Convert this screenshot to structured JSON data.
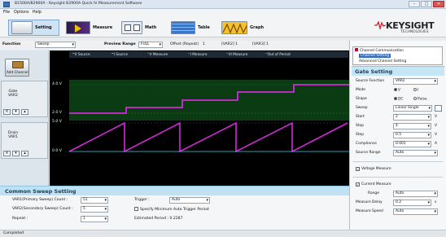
{
  "window": {
    "title": "B1500A/B2900A - Keysight B2900A Quick IV Measurement Software",
    "min_glyph": "–",
    "max_glyph": "□",
    "close_glyph": "✕"
  },
  "menu": [
    "File",
    "Options",
    "Help"
  ],
  "toolbar": {
    "setting": "Setting",
    "measure": "Measure",
    "math": "Math",
    "table": "Table",
    "graph": "Graph"
  },
  "logo": {
    "name": "KEYSIGHT",
    "sub": "TECHNOLOGIES"
  },
  "function_row": {
    "function_label": "Function",
    "function_value": "Sweep",
    "preview_label": "Preview Range",
    "preview_value": "FULL",
    "offset_label": "Offset (Repeat)",
    "offset_value": "1",
    "v1_label": "[VAR2] 1",
    "v2_label": "[VAR3] 1"
  },
  "channels": {
    "add_label": "Add Channel",
    "gate_label": "Gate\nVAR2",
    "drain_label": "Drain\nVAR1"
  },
  "legend": [
    "V Source",
    "I Source",
    "V Measure",
    "I Measure",
    "VI Measure",
    "Out of Period"
  ],
  "graph_axes": {
    "gate_top": "4.0 V",
    "gate_bottom": "2.0 V",
    "drain_top": "5.0 V",
    "drain_bottom": "0.0 V"
  },
  "common_sweep": {
    "title": "Common Sweep Setting",
    "var1_label": "VAR1(Primary Sweep) Count :",
    "var1_value": "51",
    "var2_label": "VAR2(Secondary Sweep) Count :",
    "var2_value": "5",
    "repeat_label": "Repeat :",
    "repeat_value": "1",
    "trigger_label": "Trigger :",
    "trigger_value": "Auto",
    "specify_label": "Specify Minimum Auto Trigger Period",
    "est_label": "Estimated Period : 0.2287"
  },
  "right_panel": {
    "tree": [
      "Channel Communication",
      "Channel Setting",
      "Advanced Channel Setting"
    ],
    "title": "Gate Setting",
    "source_function_label": "Source Function",
    "source_function_value": "VAR2",
    "mode_label": "Mode",
    "mode_v": "V",
    "mode_i": "I",
    "shape_label": "Shape",
    "shape_dc": "DC",
    "shape_pulse": "Pulse",
    "sweep_label": "Sweep",
    "sweep_value": "Linear Single",
    "start_label": "Start",
    "start_value": "2",
    "start_unit": "V",
    "stop_label": "Stop",
    "stop_value": "4",
    "stop_unit": "V",
    "step_label": "Step",
    "step_value": "0.5",
    "step_unit": "V",
    "compliance_label": "Compliance",
    "compliance_value": "0.001",
    "compliance_unit": "A",
    "source_range_label": "Source Range",
    "source_range_value": "Auto",
    "voltage_measure_label": "Voltage Measure",
    "current_measure_label": "Current Measure",
    "range_label": "Range",
    "range_value": "Auto",
    "delay_label": "Measure Delay",
    "delay_value": "0.2",
    "delay_unit": "s",
    "speed_label": "Measure Speed",
    "speed_value": "Auto"
  },
  "status": "Completed",
  "colors": {
    "gate_bg": "#0a3d0a",
    "trace": "#d02cd6",
    "cyan": "#3ec9e6"
  }
}
